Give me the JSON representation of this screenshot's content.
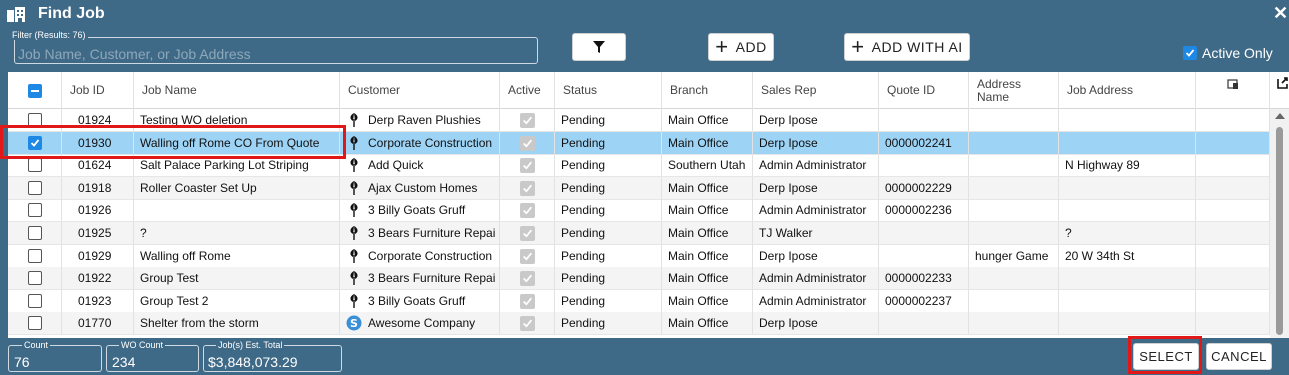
{
  "window": {
    "title": "Find Job",
    "close_glyph": "✕"
  },
  "toolbar": {
    "filter_legend": "Filter (Results: 76)",
    "filter_placeholder": "Job Name, Customer, or Job Address",
    "filter_value": "",
    "add_label": "ADD",
    "add_with_ai_label": "ADD WITH AI",
    "active_only_label": "Active Only",
    "active_only_checked": true
  },
  "columns": [
    "Job ID",
    "Job Name",
    "Customer",
    "Active",
    "Status",
    "Branch",
    "Sales Rep",
    "Quote ID",
    "Address Name",
    "Job Address"
  ],
  "rows": [
    {
      "checked": false,
      "job_id": "01924",
      "job_name": "Testing WO deletion",
      "customer": "Derp Raven Plushies",
      "customer_icon": "leaf-logo-icon",
      "active": true,
      "status": "Pending",
      "branch": "Main Office",
      "sales_rep": "Derp Ipose",
      "quote_id": "",
      "address_name": "",
      "job_address": ""
    },
    {
      "checked": true,
      "job_id": "01930",
      "job_name": "Walling off Rome CO From Quote",
      "customer": "Corporate Construction",
      "customer_icon": "leaf-logo-icon",
      "active": true,
      "status": "Pending",
      "branch": "Main Office",
      "sales_rep": "Derp Ipose",
      "quote_id": "0000002241",
      "address_name": "",
      "job_address": ""
    },
    {
      "checked": false,
      "job_id": "01624",
      "job_name": "Salt Palace Parking Lot Striping",
      "customer": "Add Quick",
      "customer_icon": "leaf-logo-icon",
      "active": true,
      "status": "Pending",
      "branch": "Southern Utah",
      "sales_rep": "Admin Administrator",
      "quote_id": "",
      "address_name": "",
      "job_address": "N Highway 89"
    },
    {
      "checked": false,
      "job_id": "01918",
      "job_name": "Roller Coaster Set Up",
      "customer": "Ajax Custom Homes",
      "customer_icon": "leaf-logo-icon",
      "active": true,
      "status": "Pending",
      "branch": "Main Office",
      "sales_rep": "Derp Ipose",
      "quote_id": "0000002229",
      "address_name": "",
      "job_address": ""
    },
    {
      "checked": false,
      "job_id": "01926",
      "job_name": "",
      "customer": "3 Billy Goats Gruff",
      "customer_icon": "leaf-logo-icon",
      "active": true,
      "status": "Pending",
      "branch": "Main Office",
      "sales_rep": "Admin Administrator",
      "quote_id": "0000002236",
      "address_name": "",
      "job_address": ""
    },
    {
      "checked": false,
      "job_id": "01925",
      "job_name": "?",
      "customer": "3 Bears Furniture Repai",
      "customer_icon": "leaf-logo-icon",
      "active": true,
      "status": "Pending",
      "branch": "Main Office",
      "sales_rep": "TJ Walker",
      "quote_id": "",
      "address_name": "",
      "job_address": "?"
    },
    {
      "checked": false,
      "job_id": "01929",
      "job_name": "Walling off Rome",
      "customer": "Corporate Construction",
      "customer_icon": "leaf-logo-icon",
      "active": true,
      "status": "Pending",
      "branch": "Main Office",
      "sales_rep": "Derp Ipose",
      "quote_id": "",
      "address_name": "hunger Game",
      "job_address": "20 W 34th St"
    },
    {
      "checked": false,
      "job_id": "01922",
      "job_name": "Group Test",
      "customer": "3 Bears Furniture Repai",
      "customer_icon": "leaf-logo-icon",
      "active": true,
      "status": "Pending",
      "branch": "Main Office",
      "sales_rep": "Admin Administrator",
      "quote_id": "0000002233",
      "address_name": "",
      "job_address": ""
    },
    {
      "checked": false,
      "job_id": "01923",
      "job_name": "Group Test 2",
      "customer": "3 Billy Goats Gruff",
      "customer_icon": "leaf-logo-icon",
      "active": true,
      "status": "Pending",
      "branch": "Main Office",
      "sales_rep": "Admin Administrator",
      "quote_id": "0000002237",
      "address_name": "",
      "job_address": ""
    },
    {
      "checked": false,
      "job_id": "01770",
      "job_name": "Shelter from the storm",
      "customer": "Awesome Company",
      "customer_icon": "s-logo-icon",
      "active": true,
      "status": "Pending",
      "branch": "Main Office",
      "sales_rep": "Derp Ipose",
      "quote_id": "",
      "address_name": "",
      "job_address": ""
    }
  ],
  "footer": {
    "count_label": "Count",
    "count_value": "76",
    "wo_count_label": "WO Count",
    "wo_count_value": "234",
    "est_total_label": "Job(s) Est. Total",
    "est_total_value": "$3,848,073.29",
    "select_label": "SELECT",
    "cancel_label": "CANCEL"
  },
  "colors": {
    "frame": "#3f6a87",
    "selected_row": "#9dd3f5",
    "checkbox_blue": "#1e88e5",
    "highlight_red": "#e01818"
  }
}
